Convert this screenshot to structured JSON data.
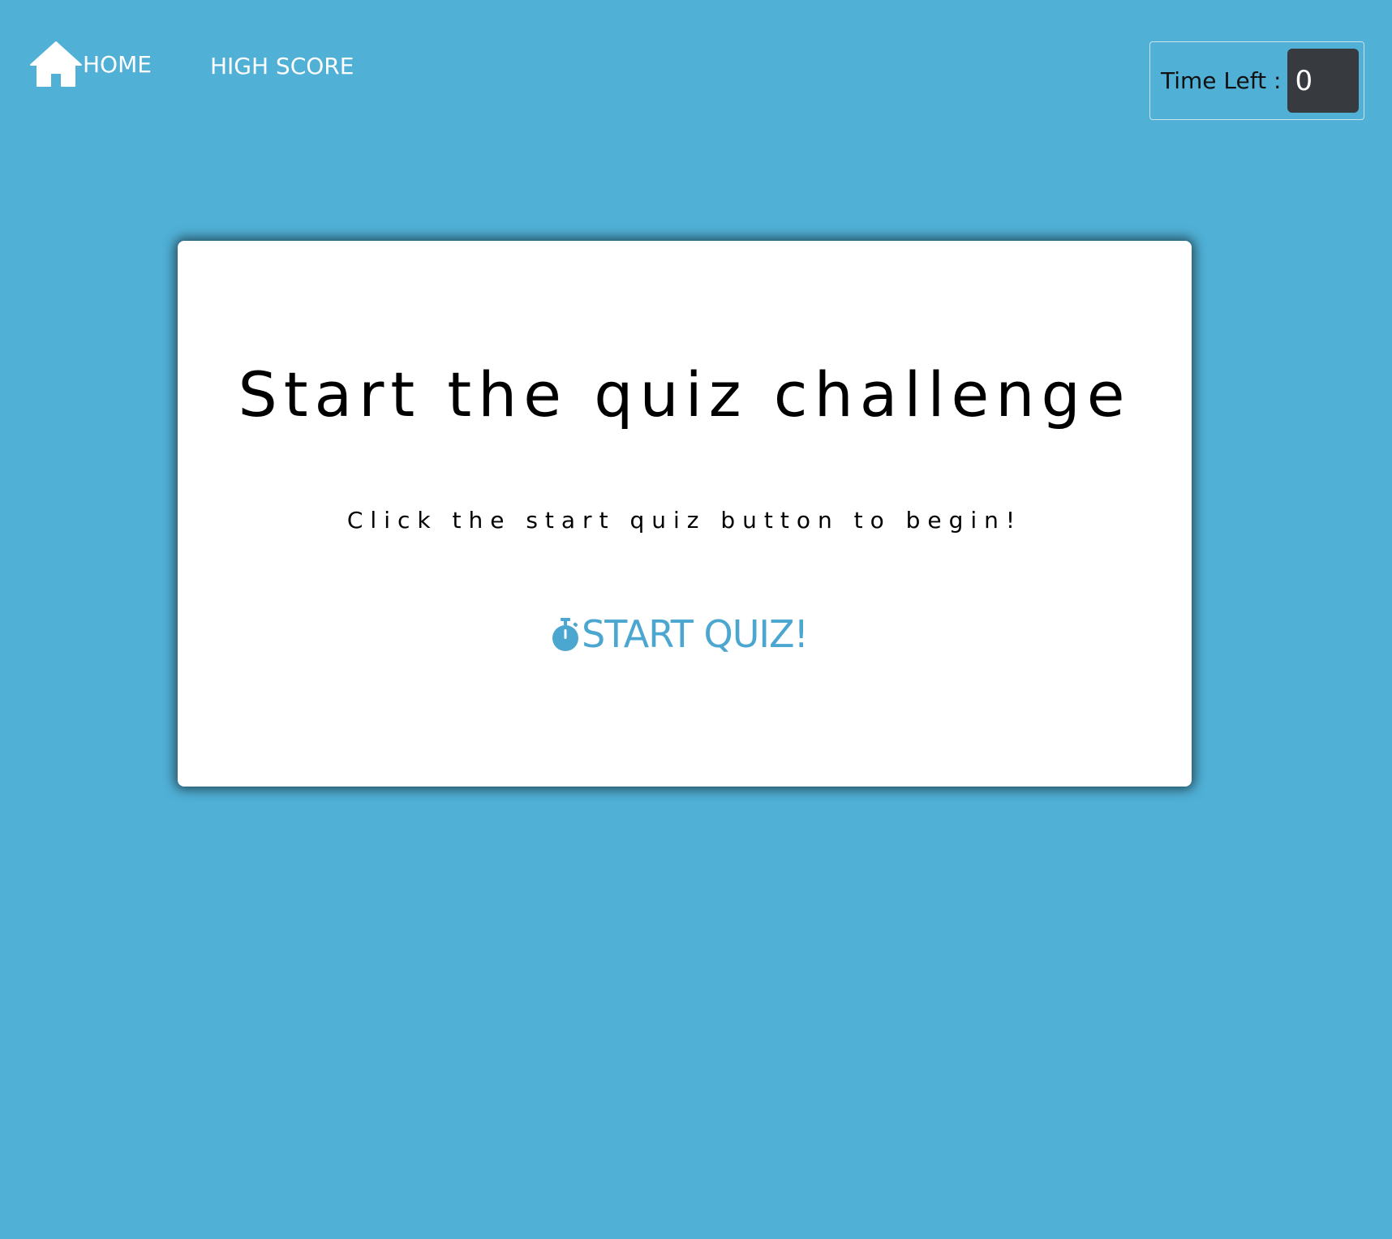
{
  "nav": {
    "home_label": "HOME",
    "highscore_label": "HIGH SCORE",
    "home_icon": "home-icon"
  },
  "timer": {
    "label": "Time Left :",
    "value": "0"
  },
  "card": {
    "title": "Start the quiz challenge",
    "subtitle": "Click the start quiz button to begin!",
    "start_button_label": "START QUIZ!",
    "start_button_icon": "stopwatch-icon"
  },
  "colors": {
    "background": "#50b0d6",
    "accent": "#4ba7cf",
    "timer_bg": "#373a3e",
    "card_bg": "#ffffff"
  }
}
